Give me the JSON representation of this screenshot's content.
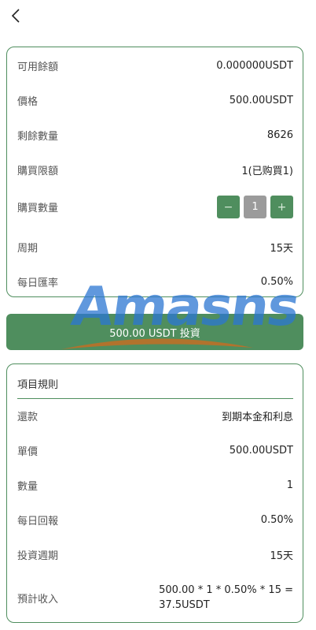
{
  "nav": {
    "back_icon": "chevron-left-icon"
  },
  "details": [
    {
      "label": "可用餘額",
      "value": "0.000000USDT"
    },
    {
      "label": "價格",
      "value": "500.00USDT"
    },
    {
      "label": "剩餘數量",
      "value": "8626"
    },
    {
      "label": "購買限額",
      "value": "1(已购買1)"
    }
  ],
  "purchase": {
    "label": "購買數量",
    "decrement": "−",
    "quantity": "1",
    "increment": "+"
  },
  "details2": [
    {
      "label": "周期",
      "value": "15天"
    },
    {
      "label": "每日匯率",
      "value": "0.50%"
    }
  ],
  "invest_button": "500.00 USDT 投資",
  "watermark": "Amasns",
  "rules": {
    "title": "項目規則",
    "rows": [
      {
        "label": "還款",
        "value": "到期本金和利息"
      },
      {
        "label": "單價",
        "value": "500.00USDT"
      },
      {
        "label": "數量",
        "value": "1"
      },
      {
        "label": "每日回報",
        "value": "0.50%"
      },
      {
        "label": "投資週期",
        "value": "15天"
      }
    ],
    "income": {
      "label": "預計收入",
      "value_line1": "500.00 * 1 * 0.50% * 15 =",
      "value_line2": "37.5USDT"
    }
  },
  "colors": {
    "accent": "#4f8e5e",
    "qty_bg": "#9b9b9b",
    "watermark": "#2b76d2"
  }
}
